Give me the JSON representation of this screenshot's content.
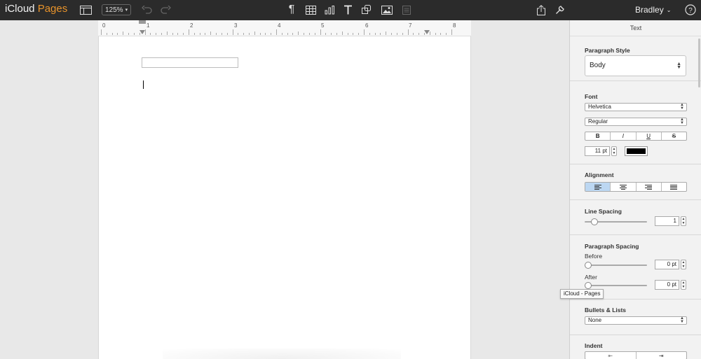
{
  "app": {
    "brand_main": "iCloud",
    "brand_accent": "Pages",
    "accent_color": "#e8932b"
  },
  "toolbar": {
    "zoom": "125%",
    "user": "Bradley",
    "icons": [
      "sidebar-toggle-icon",
      "undo-icon",
      "redo-icon",
      "paragraph-icon",
      "table-icon",
      "chart-icon",
      "text-icon",
      "shape-icon",
      "media-icon",
      "comment-icon",
      "share-icon",
      "wrench-icon",
      "help-icon"
    ]
  },
  "ruler": {
    "numbers": [
      "0",
      "1",
      "2",
      "3",
      "4",
      "5",
      "6",
      "7",
      "8"
    ]
  },
  "sidebar": {
    "tab": "Text",
    "paragraph_style": {
      "label": "Paragraph Style",
      "value": "Body"
    },
    "font": {
      "label": "Font",
      "family": "Helvetica",
      "typeface": "Regular",
      "bold": "B",
      "italic": "I",
      "underline": "U",
      "strike": "S",
      "size": "11 pt",
      "color": "#000000"
    },
    "alignment": {
      "label": "Alignment",
      "selected": "left"
    },
    "line_spacing": {
      "label": "Line Spacing",
      "value": "1"
    },
    "paragraph_spacing": {
      "label": "Paragraph Spacing",
      "before_label": "Before",
      "before_value": "0 pt",
      "after_label": "After",
      "after_value": "0 pt"
    },
    "bullets": {
      "label": "Bullets & Lists",
      "value": "None"
    },
    "indent": {
      "label": "Indent"
    }
  },
  "tooltip": "iCloud - Pages"
}
